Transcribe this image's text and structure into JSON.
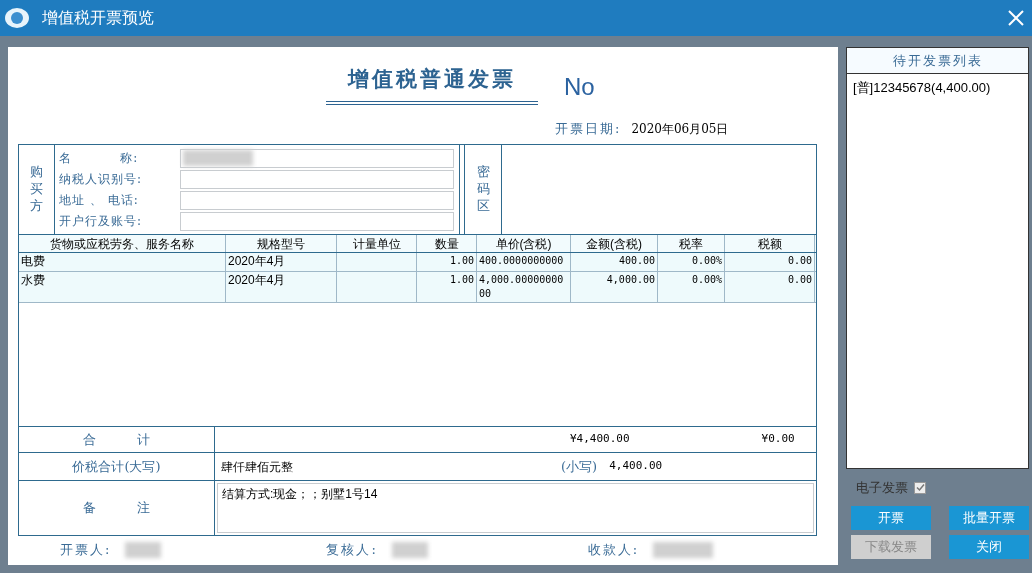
{
  "window": {
    "title": "增值税开票预览"
  },
  "invoice": {
    "title": "增值税普通发票",
    "number_label": "No",
    "date_label": "开票日期:",
    "date": "2020年06月05日",
    "buyer": {
      "heading": "购买方",
      "fields": [
        {
          "label": "名          称:"
        },
        {
          "label": "纳税人识别号:"
        },
        {
          "label": "地址 、 电话:"
        },
        {
          "label": "开户行及账号:"
        }
      ],
      "password_label": "密码区"
    },
    "items": {
      "columns": [
        "货物或应税劳务、服务名称",
        "规格型号",
        "计量单位",
        "数量",
        "单价(含税)",
        "金额(含税)",
        "税率",
        "税额"
      ],
      "rows": [
        [
          "电费",
          "2020年4月",
          "",
          "1.00",
          "400.0000000000",
          "400.00",
          "0.00%",
          "0.00"
        ],
        [
          "水费",
          "2020年4月",
          "",
          "1.00",
          "4,000.0000000000",
          "4,000.00",
          "0.00%",
          "0.00"
        ]
      ]
    },
    "total": {
      "label": "合          计",
      "amount": "¥4,400.00",
      "tax": "¥0.00"
    },
    "price_tax_total": {
      "label": "价税合计(大写)",
      "words": "肆仟肆佰元整",
      "small_label": "(小写)",
      "figure": "4,400.00"
    },
    "remarks": {
      "label": "备          注",
      "text": "结算方式:现金；；别墅1号14"
    },
    "signatures": [
      {
        "label": "开票人:"
      },
      {
        "label": "复核人:"
      },
      {
        "label": "收款人:"
      }
    ]
  },
  "pending_list": {
    "title": "待开发票列表",
    "items": [
      {
        "label": "[普]12345678(4,400.00)"
      }
    ]
  },
  "e_invoice": {
    "label": "电子发票",
    "checked": true
  },
  "buttons": [
    {
      "label": "开票",
      "disabled": false
    },
    {
      "label": "批量开票",
      "disabled": false
    },
    {
      "label": "下载发票",
      "disabled": true
    },
    {
      "label": "关闭",
      "disabled": false
    }
  ]
}
